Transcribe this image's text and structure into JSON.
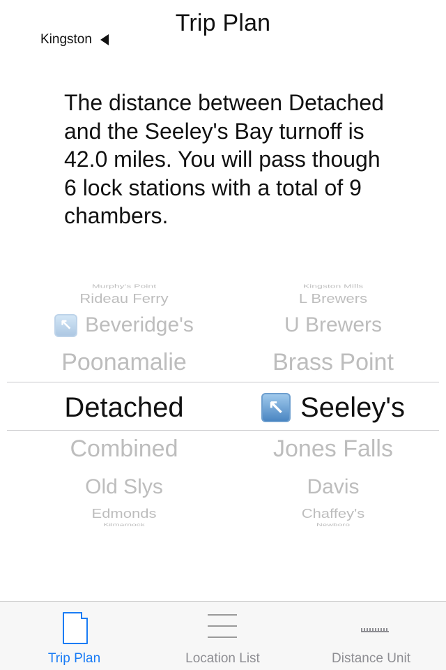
{
  "nav": {
    "title": "Trip Plan",
    "back_label": "Kingston"
  },
  "description": "The distance between Detached and the Seeley's Bay turnoff is 42.0 miles. You will pass though 6 lock stations with a total of 9 chambers.",
  "picker": {
    "left": [
      "Murphy's Point",
      "Rideau Ferry",
      "Beveridge's",
      "Poonamalie",
      "Detached",
      "Combined",
      "Old Slys",
      "Edmonds",
      "Kilmarnock"
    ],
    "right": [
      "Kingston Mills",
      "L Brewers",
      "U Brewers",
      "Brass Point",
      "Seeley's",
      "Jones Falls",
      "Davis",
      "Chaffey's",
      "Newboro"
    ],
    "left_turnoff_index": 2,
    "right_turnoff_index": 4,
    "selected_index": 4
  },
  "tabs": [
    {
      "label": "Trip Plan",
      "icon": "document-icon",
      "active": true
    },
    {
      "label": "Location List",
      "icon": "list-icon",
      "active": false
    },
    {
      "label": "Distance Unit",
      "icon": "ruler-icon",
      "active": false
    }
  ],
  "colors": {
    "accent": "#1a7cf5",
    "inactive": "#8e8e93",
    "picker_faded": "#bdbdbd"
  }
}
